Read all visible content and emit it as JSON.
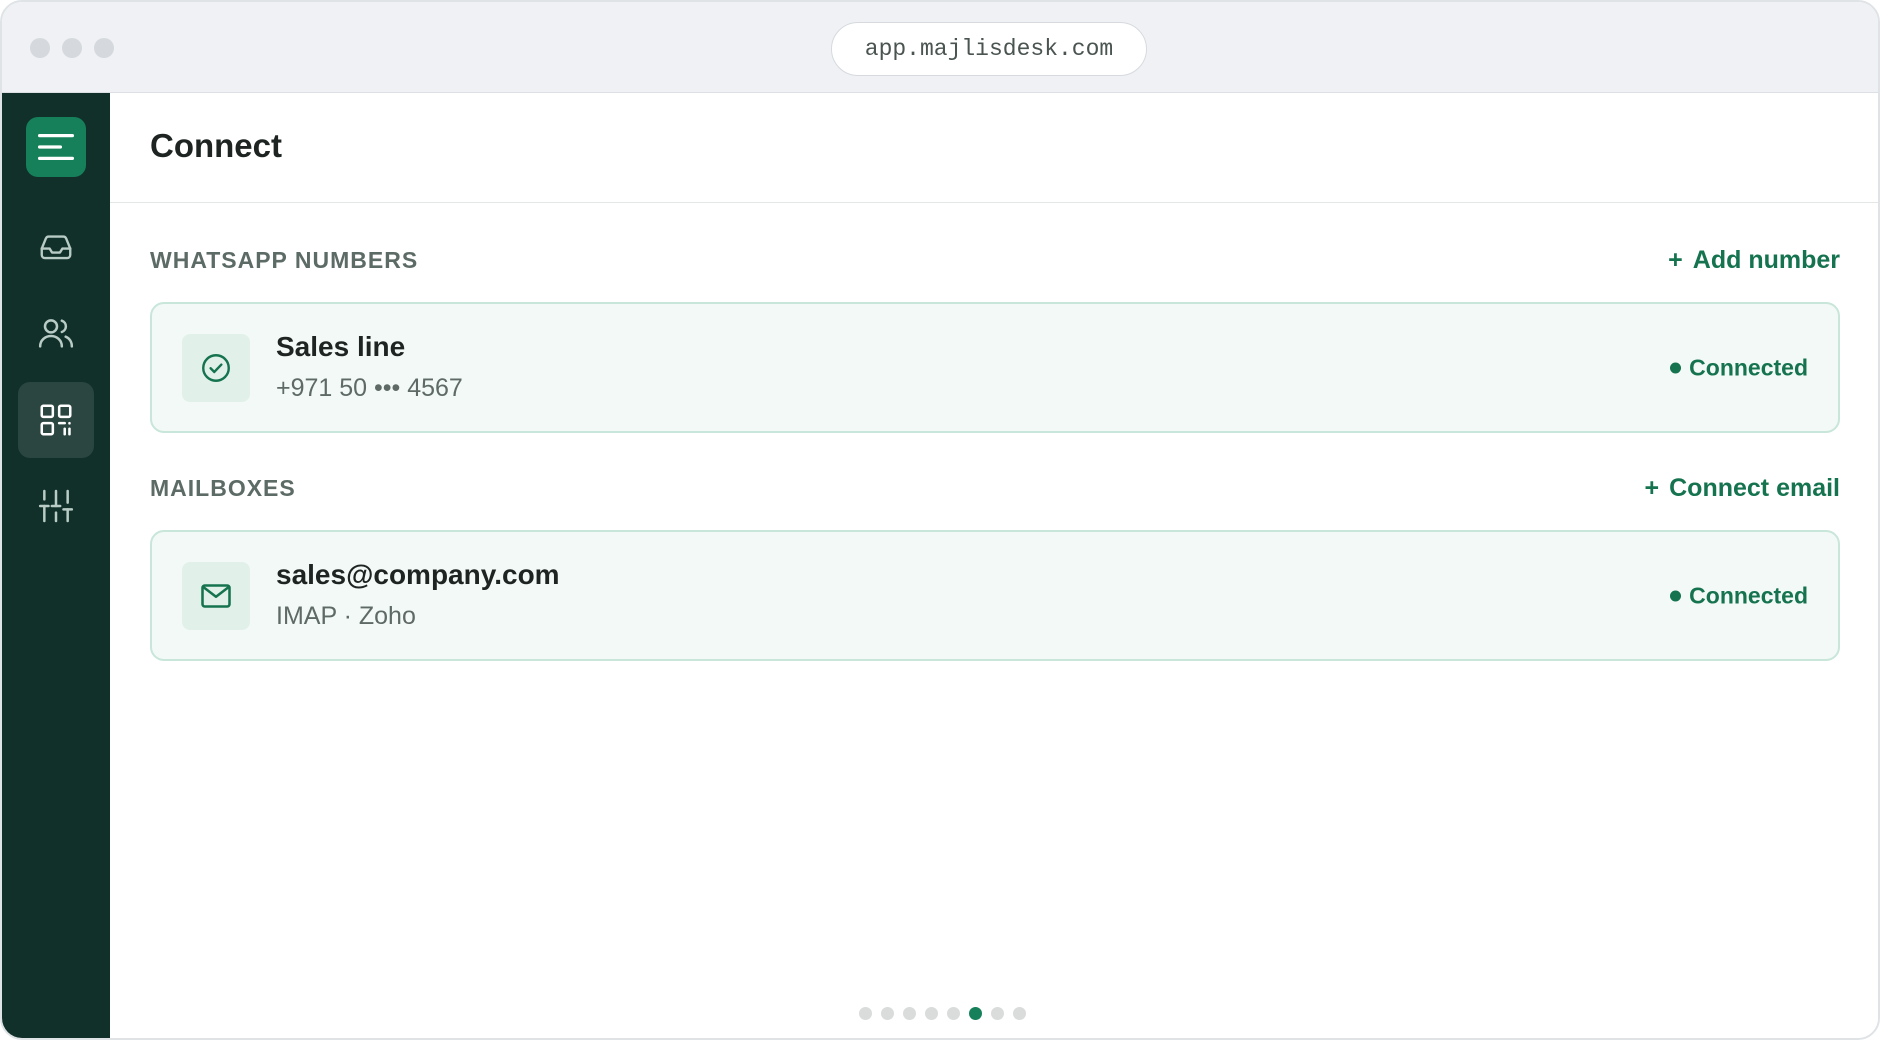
{
  "browser": {
    "url": "app.majlisdesk.com"
  },
  "sidebar": {
    "items": [
      {
        "icon": "inbox-icon",
        "active": false
      },
      {
        "icon": "users-icon",
        "active": false
      },
      {
        "icon": "apps-grid-icon",
        "active": true
      },
      {
        "icon": "sliders-icon",
        "active": false
      }
    ]
  },
  "page": {
    "title": "Connect"
  },
  "whatsapp": {
    "section_title": "WHATSAPP NUMBERS",
    "action_plus": "+",
    "action_label": "Add number",
    "card": {
      "icon": "check-circle-icon",
      "title": "Sales line",
      "subtitle": "+971 50 ••• 4567",
      "status": "Connected"
    }
  },
  "mailboxes": {
    "section_title": "MAILBOXES",
    "action_plus": "+",
    "action_label": "Connect email",
    "card": {
      "icon": "mail-icon",
      "title": "sales@company.com",
      "subtitle": "IMAP · Zoho",
      "status": "Connected"
    }
  },
  "pager": {
    "total": 8,
    "current": 6
  },
  "colors": {
    "accent": "#15734f",
    "sidebar_bg": "#11302a",
    "card_bg": "#f2f9f6",
    "card_border": "#c9e6da"
  }
}
